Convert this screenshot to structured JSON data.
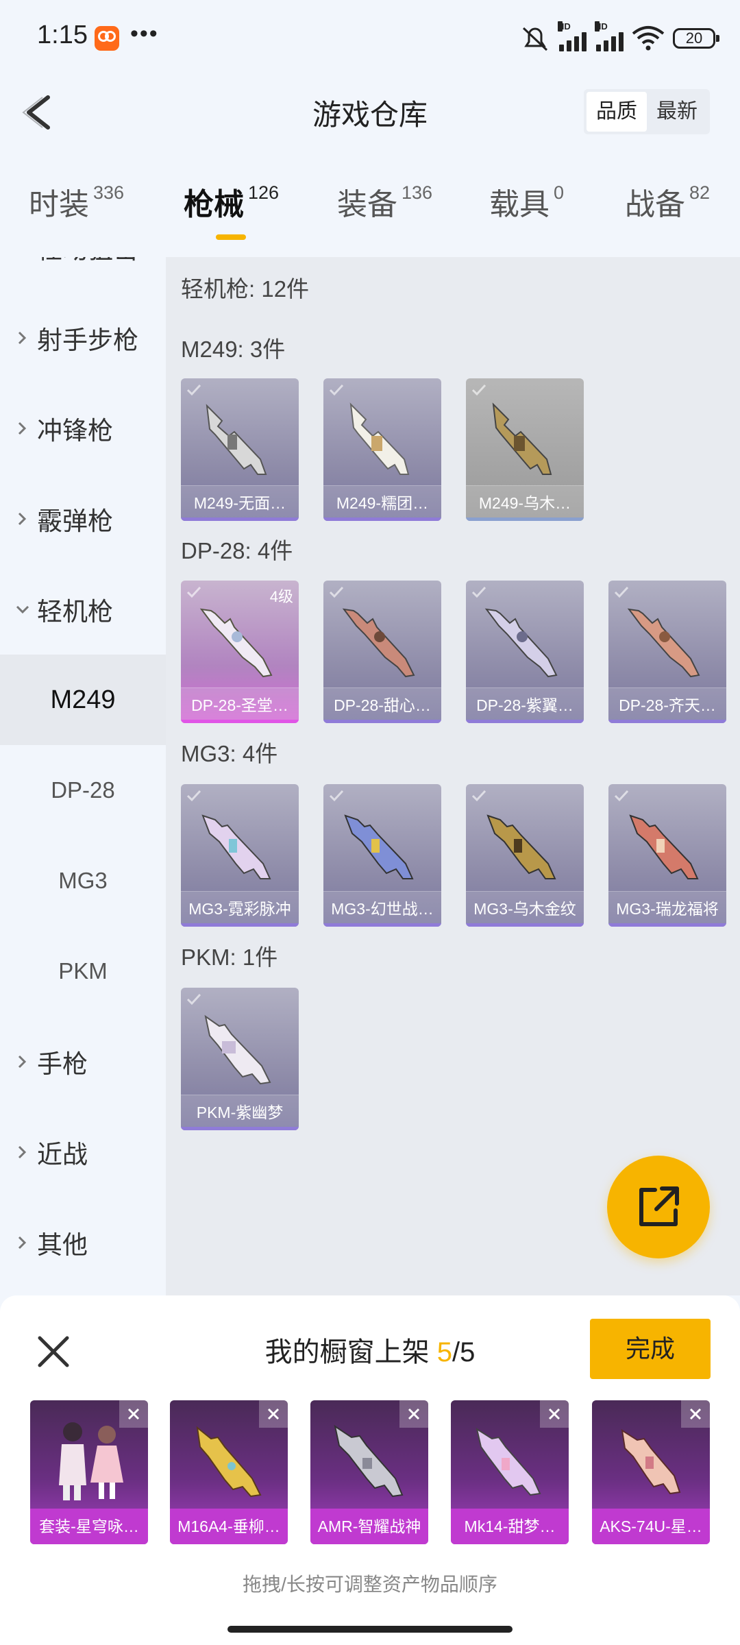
{
  "status_bar": {
    "time": "1:15",
    "dots": "•••",
    "battery": "20",
    "signal_label": "HD"
  },
  "header": {
    "title": "游戏仓库",
    "sort_options": [
      "品质",
      "最新"
    ]
  },
  "tabs": [
    {
      "label": "时装",
      "count": "336"
    },
    {
      "label": "枪械",
      "count": "126"
    },
    {
      "label": "装备",
      "count": "136"
    },
    {
      "label": "载具",
      "count": "0"
    },
    {
      "label": "战备",
      "count": "82"
    }
  ],
  "sidebar": {
    "categories": [
      "栓动狙击",
      "射手步枪",
      "冲锋枪",
      "霰弹枪",
      "轻机枪"
    ],
    "subitems": [
      "M249",
      "DP-28",
      "MG3",
      "PKM"
    ],
    "more_categories": [
      "手枪",
      "近战",
      "其他"
    ]
  },
  "content": {
    "summary": "轻机枪: 12件",
    "groups": [
      {
        "title": "M249: 3件",
        "items": [
          "M249-无面…",
          "M249-糯团…",
          "M249-乌木…"
        ]
      },
      {
        "title": "DP-28: 4件",
        "items": [
          "DP-28-圣堂…",
          "DP-28-甜心…",
          "DP-28-紫翼…",
          "DP-28-齐天…"
        ],
        "level_badge": "4级"
      },
      {
        "title": "MG3: 4件",
        "items": [
          "MG3-霓彩脉冲",
          "MG3-幻世战…",
          "MG3-乌木金纹",
          "MG3-瑞龙福将"
        ]
      },
      {
        "title": "PKM: 1件",
        "items": [
          "PKM-紫幽梦"
        ]
      }
    ]
  },
  "sheet": {
    "title": "我的橱窗上架",
    "current": "5",
    "total": "/5",
    "done_label": "完成",
    "items": [
      "套装-星穹咏…",
      "M16A4-垂柳…",
      "AMR-智耀战神",
      "Mk14-甜梦…",
      "AKS-74U-星…"
    ],
    "hint": "拖拽/长按可调整资产物品顺序"
  }
}
